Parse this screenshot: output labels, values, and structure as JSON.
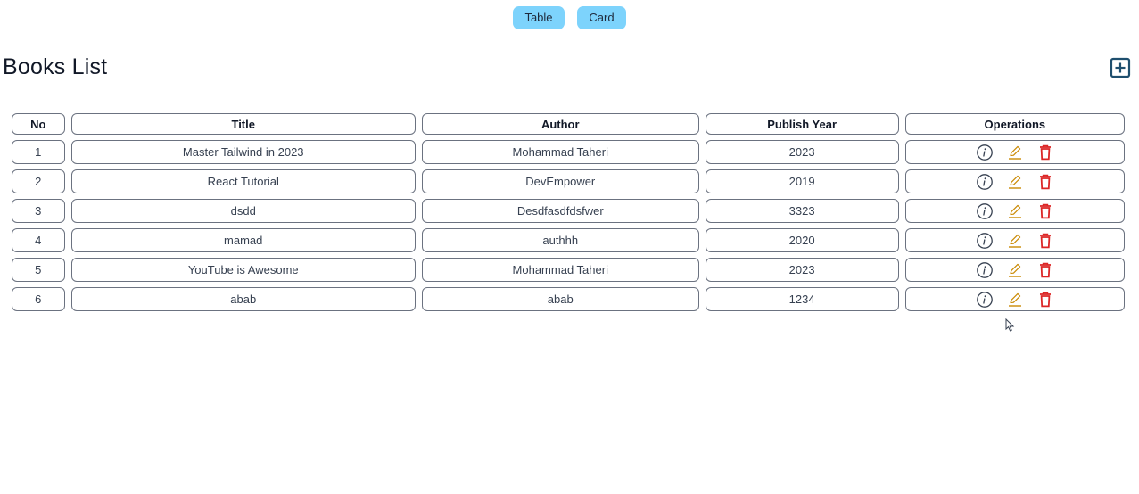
{
  "view_toggle": {
    "table_label": "Table",
    "card_label": "Card"
  },
  "header": {
    "title": "Books List",
    "add_icon": "plus-square-icon"
  },
  "table": {
    "columns": [
      "No",
      "Title",
      "Author",
      "Publish Year",
      "Operations"
    ],
    "rows": [
      {
        "no": "1",
        "title": "Master Tailwind in 2023",
        "author": "Mohammad Taheri",
        "year": "2023"
      },
      {
        "no": "2",
        "title": "React Tutorial",
        "author": "DevEmpower",
        "year": "2019"
      },
      {
        "no": "3",
        "title": "dsdd",
        "author": "Desdfasdfdsfwer",
        "year": "3323"
      },
      {
        "no": "4",
        "title": "mamad",
        "author": "authhh",
        "year": "2020"
      },
      {
        "no": "5",
        "title": "YouTube is Awesome",
        "author": "Mohammad Taheri",
        "year": "2023"
      },
      {
        "no": "6",
        "title": "abab",
        "author": "abab",
        "year": "1234"
      }
    ],
    "operation_icons": [
      "info-circle-icon",
      "edit-pencil-icon",
      "delete-trash-icon"
    ]
  },
  "colors": {
    "toggle_bg": "#7dd3fc",
    "add_icon": "#1e4f6e",
    "info_icon": "#374151",
    "edit_icon": "#ca8a04",
    "delete_icon": "#dc2626",
    "cell_border": "#6b7280"
  }
}
